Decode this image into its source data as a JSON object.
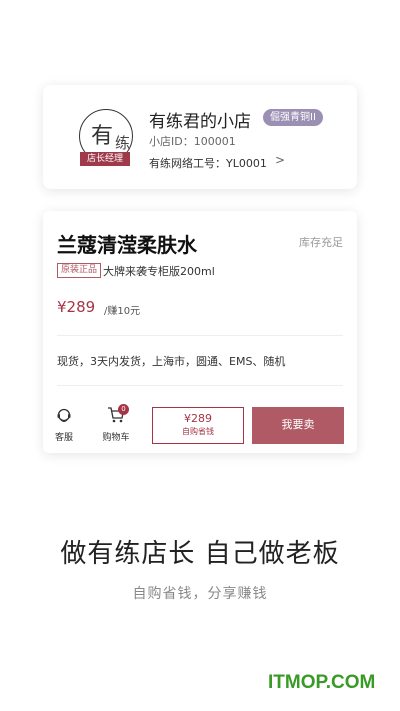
{
  "store": {
    "avatar_char_1": "有",
    "avatar_char_2": "练",
    "role_badge": "店长经理",
    "name": "有练君的小店",
    "level": "倔强青铜II",
    "store_id": "小店ID：100001",
    "work_id": "有练网络工号：YL0001",
    "chevron": ">"
  },
  "product": {
    "title": "兰蔻清滢柔肤水",
    "stock_status": "库存充足",
    "genuine_tag": "原装正品",
    "spec": "大牌来袭专柜版200ml",
    "price": "¥289",
    "earn": "/赚10元",
    "delivery": "现货，3天内发货，上海市，圆通、EMS、随机"
  },
  "actions": {
    "service_label": "客服",
    "cart_label": "购物车",
    "cart_count": "0",
    "self_buy_price": "¥289",
    "self_buy_label": "自购省钱",
    "sell_label": "我要卖"
  },
  "slogan": {
    "main": "做有练店长  自己做老板",
    "sub": "自购省钱，分享赚钱"
  },
  "watermark": "ITMOP.COM",
  "colors": {
    "accent": "#a63446",
    "sell_button": "#b05a66",
    "level_badge": "#9b8fb3",
    "watermark": "#3a9a28"
  }
}
